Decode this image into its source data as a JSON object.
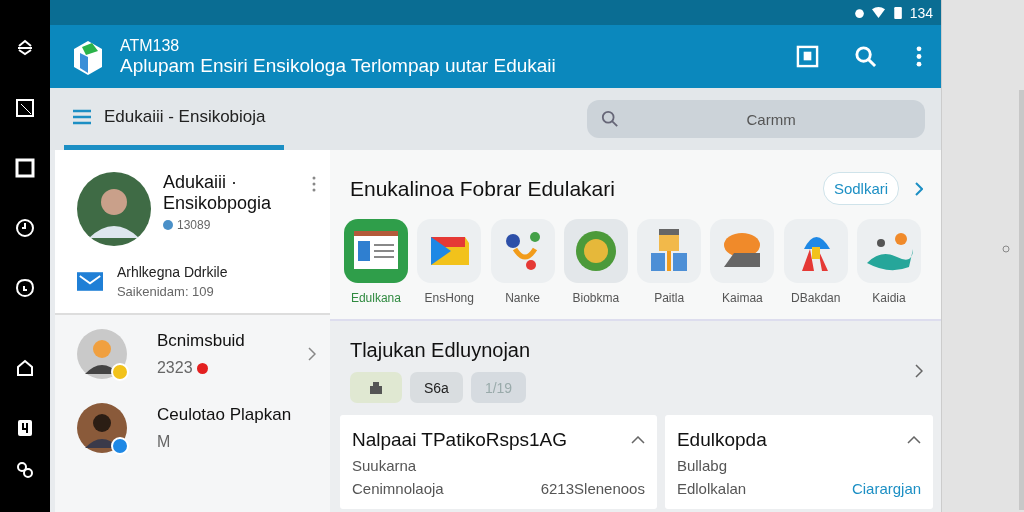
{
  "status_bar": {
    "time": "134"
  },
  "app_bar": {
    "code": "ATM138",
    "title": "Aplupam Ensiri Ensikologa Terlompap uutar Edukaii"
  },
  "tabs": [
    {
      "label": "Edukaiii - Ensikobioja",
      "selected": true
    }
  ],
  "search": {
    "placeholder": "Carmm"
  },
  "profile": {
    "name": "Adukaiii · Ensikobpogia",
    "count": "13089"
  },
  "mail": {
    "title": "Arhlkegna Ddrkile",
    "subtitle": "Saikenidam: 109"
  },
  "contacts": [
    {
      "name": "Bcnimsbuid",
      "detail": "2323",
      "color": "#f2c21b",
      "alert": true
    },
    {
      "name": "Ceulotao Plapkan",
      "detail": "M",
      "color": "#1e88e5",
      "alert": false
    }
  ],
  "featured": {
    "title": "Enukalinoa Fobrar Edulakari",
    "button": "Sodlkari",
    "apps": [
      {
        "label": "Edulkana",
        "selected": true
      },
      {
        "label": "EnsHong",
        "selected": false
      },
      {
        "label": "Nanke",
        "selected": false
      },
      {
        "label": "Biobkma",
        "selected": false
      },
      {
        "label": "Paitla",
        "selected": false
      },
      {
        "label": "Kaimaa",
        "selected": false
      },
      {
        "label": "DBakdan",
        "selected": false
      },
      {
        "label": "Kaidia",
        "selected": false
      }
    ]
  },
  "section": {
    "title": "Tlajukan Edluynojan",
    "chips": [
      {
        "kind": "icon"
      },
      {
        "kind": "text",
        "label": "S6a",
        "disabled": false
      },
      {
        "kind": "text",
        "label": "1/19",
        "disabled": true
      }
    ]
  },
  "cards": [
    {
      "title": "Nalpaai TPatikoRsps1AG",
      "line_1": "Suukarna",
      "line_2": "Cenimnolaoja",
      "value": "6213Slenenoos",
      "kind": "plain"
    },
    {
      "title": "Edulkopda",
      "line_1": "Bullabg",
      "line_2": "Edlolkalan",
      "value": "Ciarargjan",
      "kind": "link"
    }
  ]
}
